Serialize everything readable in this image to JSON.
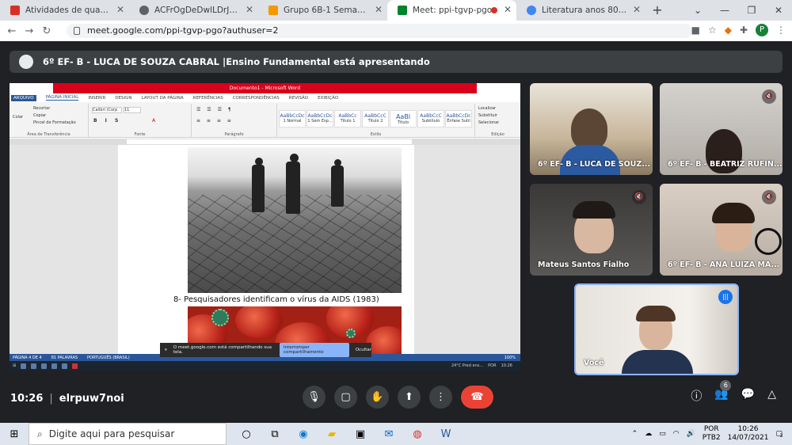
{
  "browser": {
    "tabs": [
      {
        "title": "Atividades de quarta-feira pa",
        "favicon_color": "#d93025",
        "favicon": "gmail-icon"
      },
      {
        "title": "ACFrOgDeDwlLDrJPaLmjBBbU",
        "favicon_color": "#5f6368",
        "favicon": "globe-icon"
      },
      {
        "title": "Grupo 6B-1 Semana do Carn",
        "favicon_color": "#f29900",
        "favicon": "classroom-icon"
      },
      {
        "title": "Meet: ppi-tgvp-pgo",
        "favicon_color": "#00832d",
        "favicon": "meet-icon",
        "active": true
      },
      {
        "title": "Literatura anos 80 - Pesquisa",
        "favicon_color": "#4285f4",
        "favicon": "google-icon"
      }
    ],
    "url": "meet.google.com/ppi-tgvp-pgo?authuser=2",
    "profile_initial": "P"
  },
  "presenter_bar": "6º EF- B - LUCA DE SOUZA CABRAL |Ensino Fundamental está apresentando",
  "word": {
    "window_title": "Documento1 - Microsoft Word",
    "ribbon_tabs": [
      "ARQUIVO",
      "PÁGINA INICIAL",
      "INSERIR",
      "DESIGN",
      "LAYOUT DA PÁGINA",
      "REFERÊNCIAS",
      "CORRESPONDÊNCIAS",
      "REVISÃO",
      "EXIBIÇÃO"
    ],
    "clipboard": {
      "paste": "Colar",
      "cut": "Recortar",
      "copy": "Copiar",
      "format_painter": "Pincel de Formatação",
      "label": "Área de Transferência"
    },
    "font": {
      "name": "Calibri (Corp",
      "size": "11",
      "label": "Fonte"
    },
    "paragraph_label": "Parágrafo",
    "styles": [
      {
        "sample": "AaBbCcDc",
        "name": "1 Normal"
      },
      {
        "sample": "AaBbCcDc",
        "name": "1 Sem Esp..."
      },
      {
        "sample": "AaBbCc",
        "name": "Título 1"
      },
      {
        "sample": "AaBbCcC",
        "name": "Título 2"
      },
      {
        "sample": "AaBl",
        "name": "Título"
      },
      {
        "sample": "AaBbCcC",
        "name": "Subtítulo"
      },
      {
        "sample": "AaBbCcDc",
        "name": "Ênfase Sutil"
      }
    ],
    "styles_label": "Estilo",
    "editing": {
      "find": "Localizar",
      "replace": "Substituir",
      "select": "Selecionar",
      "label": "Edição"
    },
    "caption": "8- Pesquisadores identificam o vírus da AIDS (1983)",
    "status": {
      "page": "PÁGINA 4 DE 4",
      "words": "81 PALAVRAS",
      "lang": "PORTUGUÊS (BRASIL)",
      "zoom": "100%"
    },
    "inner_taskbar": {
      "weather": "24°C  Pred ens...",
      "lang": "POR",
      "time": "10:26"
    }
  },
  "share_notice": {
    "text": "O meet.google.com está compartilhando sua tela.",
    "stop": "Interromper compartilhamento",
    "hide": "Ocultar"
  },
  "participants": [
    {
      "name": "6º EF- B - LUCA DE SOUZ...",
      "muted": false,
      "bg": "#c9b99f"
    },
    {
      "name": "6º EF- B - BEATRIZ RUFIN...",
      "muted": true,
      "bg": "#b7b3ae"
    },
    {
      "name": "Mateus Santos Fialho",
      "muted": true,
      "bg": "#4d4b4a"
    },
    {
      "name": "6º EF- B - ANA LUIZA MA...",
      "muted": true,
      "bg": "#c7bfb8"
    }
  ],
  "self_tile": {
    "name": "Você"
  },
  "meeting": {
    "time": "10:26",
    "code": "elrpuw7noi",
    "participant_count": "6"
  },
  "taskbar": {
    "search_placeholder": "Digite aqui para pesquisar",
    "lang": "POR",
    "lang2": "PTB2",
    "time": "10:26",
    "date": "14/07/2021",
    "notifications": "3"
  }
}
